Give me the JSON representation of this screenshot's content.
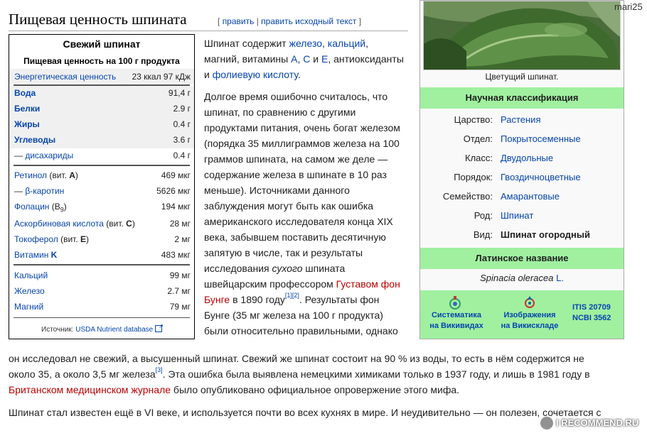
{
  "heading": {
    "title": "Пищевая ценность шпината",
    "edit_open": "[",
    "edit_link": "править",
    "edit_sep": "|",
    "edit_source_link": "править исходный текст",
    "edit_close": "]"
  },
  "user": "mari25",
  "nutrition": {
    "title": "Свежий шпинат",
    "subtitle": "Пищевая ценность на 100 г продукта",
    "energy": {
      "label": "Энергетическая ценность",
      "value": "23 ккал 97 кДж"
    },
    "macros": [
      {
        "label": "Вода",
        "value": "91,4 г"
      },
      {
        "label": "Белки",
        "value": "2.9 г"
      },
      {
        "label": "Жиры",
        "value": "0.4 г"
      },
      {
        "label": "Углеводы",
        "value": "3.6 г"
      },
      {
        "prefix": "— ",
        "label": "дисахариды",
        "value": "0.4 г"
      }
    ],
    "vitamins": [
      {
        "label": "Ретинол",
        "suffix": " (вит. ",
        "letter": "A",
        "close": ")",
        "value": "469 мкг"
      },
      {
        "prefix": "— ",
        "label": "β-каротин",
        "value": "5626 мкг"
      },
      {
        "label": "Фолацин",
        "paren_open": " (B",
        "sub": "9",
        "paren_close": ")",
        "value": "194 мкг"
      },
      {
        "label": "Аскорбиновая кислота",
        "suffix": " (вит. ",
        "letter": "C",
        "close": ")",
        "value": "28 мг"
      },
      {
        "label": "Токоферол",
        "suffix": " (вит. ",
        "letter": "E",
        "close": ")",
        "value": "2 мг"
      },
      {
        "label": "Витамин ",
        "letter": "K",
        "value": "483 мкг"
      }
    ],
    "minerals": [
      {
        "label": "Кальций",
        "value": "99 мг"
      },
      {
        "label": "Железо",
        "value": "2.7 мг"
      },
      {
        "label": "Магний",
        "value": "79 мг"
      }
    ],
    "source_label": "Источник:",
    "source_link": "USDA Nutrient database"
  },
  "taxobox": {
    "caption": "Цветущий шпинат.",
    "classification_title": "Научная классификация",
    "ranks": [
      {
        "rank": "Царство:",
        "value": "Растения"
      },
      {
        "rank": "Отдел:",
        "value": "Покрытосеменные"
      },
      {
        "rank": "Класс:",
        "value": "Двудольные"
      },
      {
        "rank": "Порядок:",
        "value": "Гвоздичноцветные"
      },
      {
        "rank": "Семейство:",
        "value": "Амарантовые"
      },
      {
        "rank": "Род:",
        "value": "Шпинат"
      },
      {
        "rank": "Вид:",
        "value": "Шпинат огородный"
      }
    ],
    "latin_title": "Латинское название",
    "latin_name": "Spinacia oleracea",
    "latin_author": "L.",
    "links": {
      "wikispecies_line1": "Систематика",
      "wikispecies_line2": "на Викивидах",
      "commons_line1": "Изображения",
      "commons_line2": "на Викискладе",
      "itis": "ITIS 20709",
      "ncbi": "NCBI 3562"
    }
  },
  "text": {
    "p1": {
      "l1a": "Шпинат содержит ",
      "l1b": "железо",
      "l1c": ", ",
      "l1d": "кальций",
      "l1e": ",",
      "l2a": "магний, витамины ",
      "l2b": "A",
      "l2c": ", ",
      "l2d": "C",
      "l2e": " и ",
      "l2f": "E",
      "l2g": ", антиоксиданты",
      "l3a": "и ",
      "l3b": "фолиевую кислоту",
      "l3c": "."
    },
    "p2": [
      "Долгое время ошибочно считалось, что",
      "шпинат, по сравнению с другими",
      "продуктами питания, очень богат железом",
      "(порядка 35 миллиграммов железа на 100",
      "граммов шпината, на самом же деле —",
      "содержание железа в шпинате в 10 раз",
      "меньше). Источниками данного",
      "заблуждения могут быть как ошибка",
      "американского исследователя конца XIX",
      "века, забывшем поставить десятичную",
      "запятую в числе, так и результаты"
    ],
    "p2_l12a": "исследования ",
    "p2_l12b": "сухого",
    "p2_l12c": " шпината",
    "p2_l13a": "швейцарским профессором ",
    "p2_l13b": "Густавом фон",
    "p2_l14a": "Бунге",
    "p2_l14b": " в 1890 году",
    "p2_ref1": "[1]",
    "p2_ref2": "[2]",
    "p2_l14c": ". Результаты фон",
    "p2_l15": "Бунге (35 мг железа на 100 г продукта)",
    "p2_l16": "были относительно правильными, однако",
    "p2_l17": "он исследовал не свежий, а высушенный шпинат. Свежий же шпинат состоит на 90 % из воды, то есть в нём содержится не",
    "p2_l18a": "около 35, а около 3,5 мг железа",
    "p2_ref3": "[3]",
    "p2_l18b": ". Эта ошибка была выявлена немецкими химиками только в 1937 году, и лишь в 1981 году в",
    "p2_l19a": "Британском медицинском журнале",
    "p2_l19b": " было опубликовано официальное опровержение этого мифа.",
    "p3": "Шпинат стал известен ещё в VI веке, и используется почти во всех кухнях в мире. И неудивительно — он полезен, сочетается с"
  },
  "watermark": "I RECOMMEND.RU"
}
